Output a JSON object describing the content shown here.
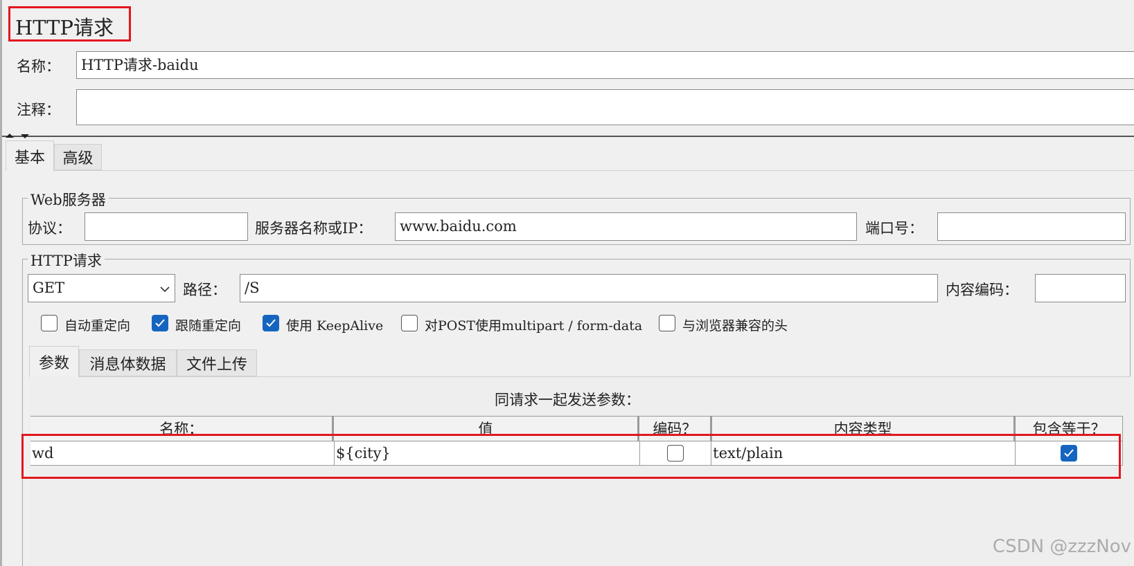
{
  "panel": {
    "title": "HTTP请求"
  },
  "name_field": {
    "label": "名称：",
    "value": "HTTP请求-baidu"
  },
  "comment_field": {
    "label": "注释：",
    "value": ""
  },
  "tabs": [
    {
      "label": "基本"
    },
    {
      "label": "高级"
    }
  ],
  "web_server": {
    "legend": "Web服务器",
    "protocol_label": "协议：",
    "protocol_value": "",
    "server_label": "服务器名称或IP：",
    "server_value": "www.baidu.com",
    "port_label": "端口号：",
    "port_value": ""
  },
  "http_request": {
    "legend": "HTTP请求",
    "method": "GET",
    "path_label": "路径：",
    "path_value": "/S",
    "encoding_label": "内容编码：",
    "encoding_value": ""
  },
  "options": [
    {
      "label": "自动重定向",
      "checked": false
    },
    {
      "label": "跟随重定向",
      "checked": true
    },
    {
      "label": "使用 KeepAlive",
      "checked": true
    },
    {
      "label": "对POST使用multipart / form-data",
      "checked": false
    },
    {
      "label": "与浏览器兼容的头",
      "checked": false
    }
  ],
  "sub_tabs": [
    {
      "label": "参数"
    },
    {
      "label": "消息体数据"
    },
    {
      "label": "文件上传"
    }
  ],
  "params": {
    "caption": "同请求一起发送参数：",
    "headers": [
      "名称：",
      "值",
      "编码？",
      "内容类型",
      "包含等于？"
    ],
    "rows": [
      {
        "name": "wd",
        "value": "${city}",
        "encode": false,
        "content_type": "text/plain",
        "include_equals": true
      }
    ]
  },
  "watermark": "CSDN @zzzNov",
  "colors": {
    "highlight": "#e3161e",
    "checkbox_checked": "#1565c0",
    "background": "#f0f0f0"
  }
}
